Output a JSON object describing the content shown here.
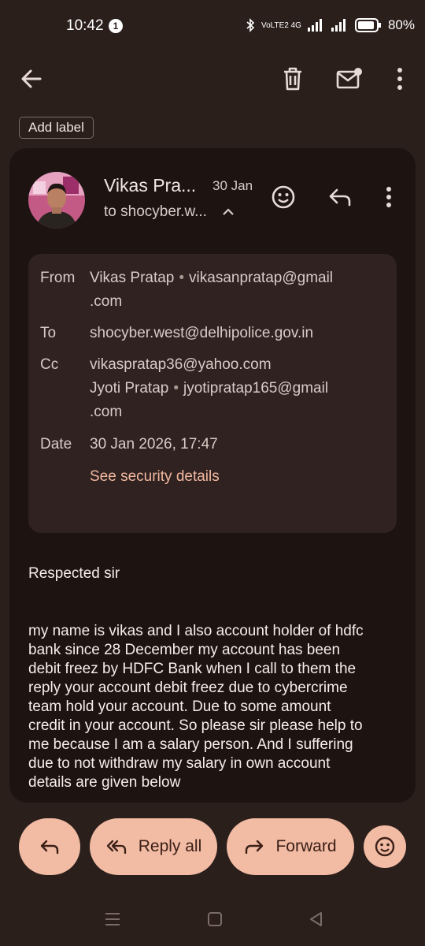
{
  "status_bar": {
    "time": "10:42",
    "notification_count": "1",
    "network": "VoLTE2 4G",
    "battery": "80%"
  },
  "label_chip": "Add label",
  "email": {
    "sender_short": "Vikas Pra...",
    "date_short": "30 Jan",
    "to_short": "to shocyber.w...",
    "details": {
      "from_label": "From",
      "from_name": "Vikas Pratap",
      "from_email_1": "vikasanpratap@gmail",
      "from_email_2": ".com",
      "to_label": "To",
      "to_value": "shocyber.west@delhipolice.gov.in",
      "cc_label": "Cc",
      "cc_1": "vikaspratap36@yahoo.com",
      "cc_2_name": "Jyoti Pratap",
      "cc_2_email_1": "jyotipratap165@gmail",
      "cc_2_email_2": ".com",
      "date_label": "Date",
      "date_value": "30 Jan 2026, 17:47",
      "security_link": "See security details"
    },
    "greeting": "Respected sir",
    "body_lines": [
      "my name is vikas and I also account holder of hdfc",
      "bank since 28 December my account has been",
      "debit freez by HDFC Bank when I call to them the",
      "reply your account debit freez due to cybercrime",
      "team hold your account. Due to some amount",
      "credit in your account. So please sir please help to",
      "me because I am a salary person. And I suffering",
      "due to not withdraw my salary in own account",
      "details are given below"
    ]
  },
  "actions": {
    "reply_all": "Reply all",
    "forward": "Forward"
  },
  "colors": {
    "background": "#2b1f1c",
    "card": "#1d1412",
    "accent_pill": "#f2bba3",
    "link": "#f2b8a0"
  }
}
